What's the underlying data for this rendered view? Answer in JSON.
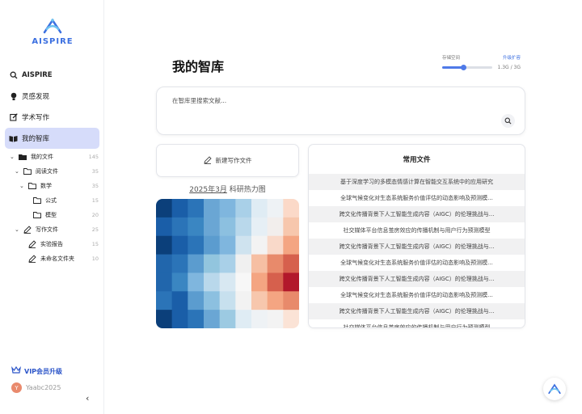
{
  "brand": {
    "name": "AISPIRE"
  },
  "nav": {
    "items": [
      {
        "label": "AISPIRE",
        "icon": "search-icon"
      },
      {
        "label": "灵感发现",
        "icon": "bulb-icon"
      },
      {
        "label": "学术写作",
        "icon": "edit-icon"
      },
      {
        "label": "我的智库",
        "icon": "book-icon"
      }
    ]
  },
  "tree": {
    "my_files": {
      "label": "我的文件",
      "count": "145"
    },
    "reading": {
      "label": "阅读文件",
      "count": "35"
    },
    "math": {
      "label": "数学",
      "count": "35"
    },
    "formula": {
      "label": "公式",
      "count": "15"
    },
    "model": {
      "label": "模型",
      "count": "20"
    },
    "writing": {
      "label": "写作文件",
      "count": "25"
    },
    "experiment": {
      "label": "实验报告",
      "count": "15"
    },
    "unnamed": {
      "label": "未命名文件夹",
      "count": "10"
    }
  },
  "footer": {
    "vip_label": "VIP会员升级",
    "avatar_letter": "Y",
    "username": "Yaabc2025"
  },
  "page": {
    "title": "我的智库"
  },
  "storage": {
    "label": "存储空间",
    "upgrade": "升级扩容",
    "usage": "1.3G / 3G",
    "fraction": 0.43
  },
  "search": {
    "placeholder": "在智库里搜索文献..."
  },
  "new_doc": {
    "label": "新建写作文件"
  },
  "heatmap": {
    "month": "2025年3月",
    "title": "科研热力图"
  },
  "common": {
    "title": "常用文件",
    "items": [
      "基于深度学习的多模态情感计算在智能交互系统中的应用研究",
      "全球气候变化对生态系统服务价值评估的动态影响及预测模...",
      "跨文化传播背景下人工智能生成内容（AIGC）的伦理挑战与...",
      "社交媒体平台信息茧房效应的传播机制与用户行为预测模型",
      "跨文化传播背景下人工智能生成内容（AIGC）的伦理挑战与...",
      "全球气候变化对生态系统服务价值评估的动态影响及预测模...",
      "跨文化传播背景下人工智能生成内容（AIGC）的伦理挑战与...",
      "全球气候变化对生态系统服务价值评估的动态影响及预测模...",
      "跨文化传播背景下人工智能生成内容（AIGC）的伦理挑战与...",
      "社交媒体平台信息茧房效应的传播机制与用户行为预测模型"
    ]
  },
  "colors": {
    "accent": "#3b6fe0",
    "active_nav": "#d6dcfa"
  }
}
